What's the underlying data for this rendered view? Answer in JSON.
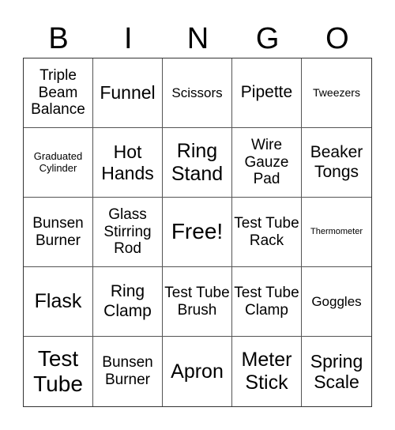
{
  "header": [
    "B",
    "I",
    "N",
    "G",
    "O"
  ],
  "cells": [
    "Triple Beam Balance",
    "Funnel",
    "Scissors",
    "Pipette",
    "Tweezers",
    "Graduated Cylinder",
    "Hot Hands",
    "Ring Stand",
    "Wire Gauze Pad",
    "Beaker Tongs",
    "Bunsen Burner",
    "Glass Stirring Rod",
    "Free!",
    "Test Tube Rack",
    "Thermometer",
    "Flask",
    "Ring Clamp",
    "Test Tube Brush",
    "Test Tube Clamp",
    "Goggles",
    "Test Tube",
    "Bunsen Burner",
    "Apron",
    "Meter Stick",
    "Spring Scale"
  ]
}
